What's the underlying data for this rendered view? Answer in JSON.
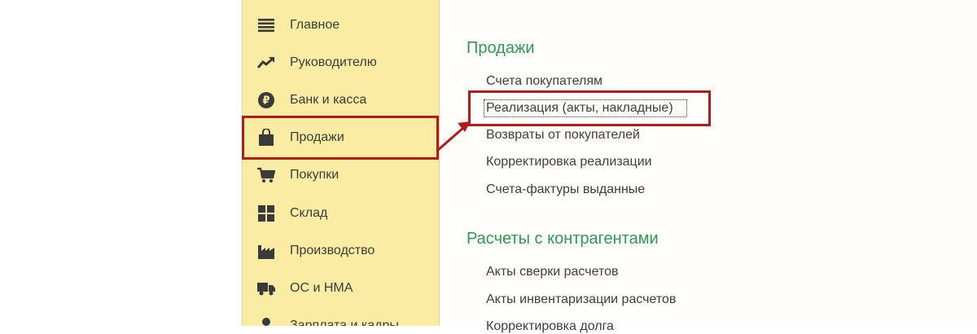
{
  "sidebar": {
    "items": [
      {
        "label": "Главное",
        "icon": "list-lines-icon"
      },
      {
        "label": "Руководителю",
        "icon": "trend-up-icon"
      },
      {
        "label": "Банк и касса",
        "icon": "ruble-coin-icon"
      },
      {
        "label": "Продажи",
        "icon": "shopping-bag-icon"
      },
      {
        "label": "Покупки",
        "icon": "shopping-cart-icon"
      },
      {
        "label": "Склад",
        "icon": "warehouse-grid-icon"
      },
      {
        "label": "Производство",
        "icon": "factory-icon"
      },
      {
        "label": "ОС и НМА",
        "icon": "truck-icon"
      },
      {
        "label": "Зарплата и кадры",
        "icon": "person-icon"
      }
    ]
  },
  "content": {
    "sections": [
      {
        "title": "Продажи",
        "links": [
          "Счета покупателям",
          "Реализация (акты, накладные)",
          "Возвраты от покупателей",
          "Корректировка реализации",
          "Счета-фактуры выданные"
        ]
      },
      {
        "title": "Расчеты с контрагентами",
        "links": [
          "Акты сверки расчетов",
          "Акты инвентаризации расчетов",
          "Корректировка долга"
        ]
      }
    ]
  },
  "colors": {
    "sidebar_bg": "#fbeca3",
    "section_title": "#2a9a55",
    "highlight": "#b31b1b"
  }
}
